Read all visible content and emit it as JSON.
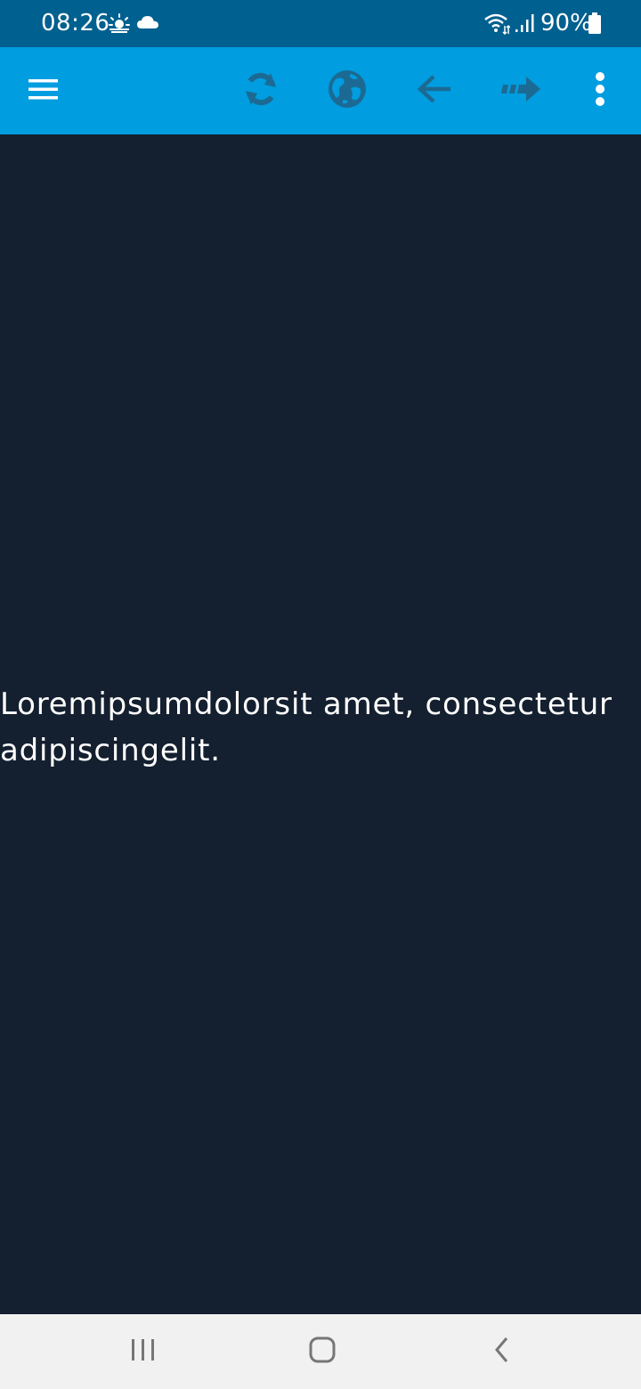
{
  "status_bar": {
    "time": "08:26",
    "battery": "90%",
    "icons": [
      "weather-sun-icon",
      "cloud-icon",
      "wifi-icon",
      "signal-icon",
      "battery-icon"
    ]
  },
  "toolbar": {
    "icons": [
      "menu-icon",
      "refresh-icon",
      "globe-icon",
      "back-arrow-icon",
      "forward-arrow-icon",
      "more-vert-icon"
    ],
    "color_primary": "#009de0",
    "color_icon_disabled": "#1c6a93"
  },
  "content": {
    "text": "Loremipsumdolorsit amet, consectetur adipiscingelit."
  },
  "nav_bar": {
    "icons": [
      "recent-apps-icon",
      "home-icon",
      "back-icon"
    ]
  }
}
